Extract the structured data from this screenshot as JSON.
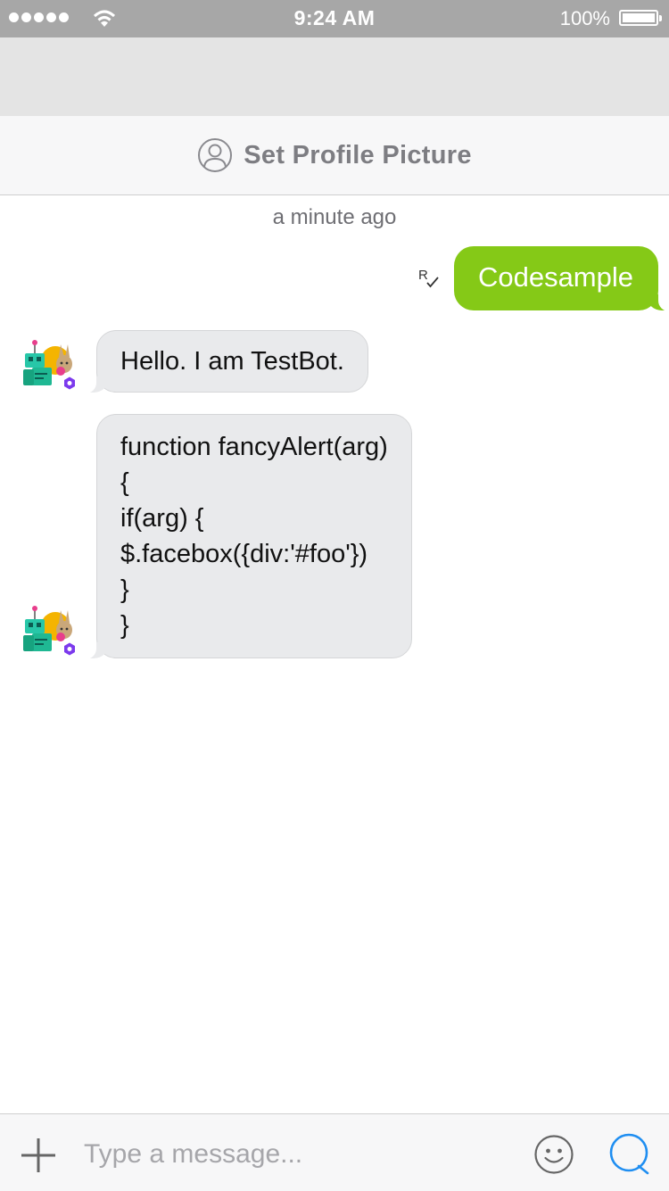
{
  "status_bar": {
    "time": "9:24 AM",
    "battery_percent": "100%",
    "battery_level": 1.0,
    "signal_bars": 5
  },
  "profile_bar": {
    "label": "Set Profile Picture",
    "icon": "user-circle-icon"
  },
  "conversation": {
    "timestamp": "a minute ago",
    "sent": {
      "text": "Codesample",
      "receipt_icon": "read-receipt-icon",
      "receipt_label": "R"
    },
    "received": [
      {
        "sender_avatar": "testbot-avatar",
        "lines": [
          "Hello. I am TestBot."
        ]
      },
      {
        "sender_avatar": "testbot-avatar",
        "lines": [
          "function fancyAlert(arg)",
          "{",
          "if(arg) {",
          "$.facebox({div:'#foo'})",
          "}",
          "}"
        ]
      }
    ]
  },
  "composer": {
    "placeholder": "Type a message...",
    "value": "",
    "icons": [
      "plus-icon",
      "emoji-icon",
      "chat-bubble-icon"
    ]
  },
  "colors": {
    "sent_bubble": "#85c917",
    "received_bubble": "#e9eaec",
    "accent": "#1f8ef1",
    "status_bar": "#a7a7a7"
  }
}
